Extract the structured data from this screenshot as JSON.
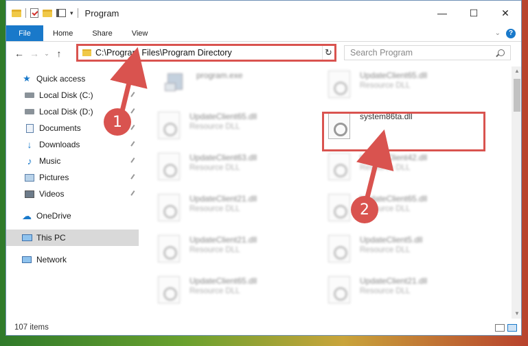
{
  "window": {
    "title": "Program",
    "controls": {
      "minimize": "—",
      "maximize": "☐",
      "close": "✕"
    }
  },
  "ribbon": {
    "file_tab": "File",
    "tabs": [
      "Home",
      "Share",
      "View"
    ],
    "help": "?"
  },
  "address_bar": {
    "path": "C:\\Program Files\\Program Directory",
    "search_placeholder": "Search Program"
  },
  "nav": {
    "quick_access": "Quick access",
    "items": [
      {
        "label": "Local Disk (C:)",
        "icon": "drive-icon",
        "pinned": true
      },
      {
        "label": "Local Disk (D:)",
        "icon": "drive-icon",
        "pinned": true
      },
      {
        "label": "Documents",
        "icon": "documents-icon",
        "pinned": true
      },
      {
        "label": "Downloads",
        "icon": "downloads-icon",
        "pinned": true
      },
      {
        "label": "Music",
        "icon": "music-icon",
        "pinned": true
      },
      {
        "label": "Pictures",
        "icon": "pictures-icon",
        "pinned": true
      },
      {
        "label": "Videos",
        "icon": "videos-icon",
        "pinned": true
      }
    ],
    "onedrive": "OneDrive",
    "this_pc": "This PC",
    "network": "Network"
  },
  "files": {
    "left": [
      {
        "name": "program.exe",
        "type": ""
      },
      {
        "name": "UpdateClient65.dll",
        "type": "Resource DLL"
      },
      {
        "name": "UpdateClient63.dll",
        "type": "Resource DLL"
      },
      {
        "name": "UpdateClient21.dll",
        "type": "Resource DLL"
      },
      {
        "name": "UpdateClient21.dll",
        "type": "Resource DLL"
      },
      {
        "name": "UpdateClient65.dll",
        "type": "Resource DLL"
      }
    ],
    "right": [
      {
        "name": "UpdateClient65.dll",
        "type": "Resource DLL"
      },
      {
        "name": "system86ta.dll",
        "type": ""
      },
      {
        "name": "UpdateClient42.dll",
        "type": "Resource DLL"
      },
      {
        "name": "UpdateClient65.dll",
        "type": "Resource DLL"
      },
      {
        "name": "UpdateClient5.dll",
        "type": "Resource DLL"
      },
      {
        "name": "UpdateClient21.dll",
        "type": "Resource DLL"
      }
    ]
  },
  "status": {
    "item_count": "107 items"
  },
  "callouts": {
    "one": "1",
    "two": "2"
  },
  "colors": {
    "accent": "#1979ca",
    "highlight": "#d9534f"
  }
}
